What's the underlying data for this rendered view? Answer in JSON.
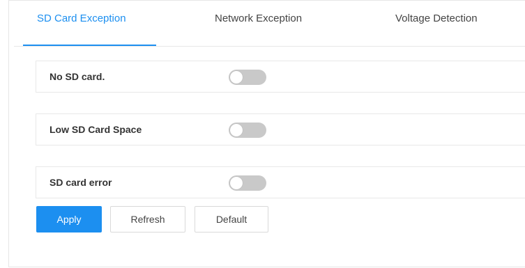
{
  "tabs": [
    {
      "label": "SD Card Exception",
      "active": true
    },
    {
      "label": "Network Exception",
      "active": false
    },
    {
      "label": "Voltage Detection",
      "active": false
    }
  ],
  "rows": [
    {
      "label": "No SD card.",
      "enabled": false
    },
    {
      "label": "Low SD Card Space",
      "enabled": false
    },
    {
      "label": "SD card error",
      "enabled": false
    }
  ],
  "buttons": {
    "apply": "Apply",
    "refresh": "Refresh",
    "default": "Default"
  },
  "colors": {
    "accent": "#1c8ff0",
    "switch_off": "#c9c9c9",
    "border": "#e8e8e8"
  }
}
